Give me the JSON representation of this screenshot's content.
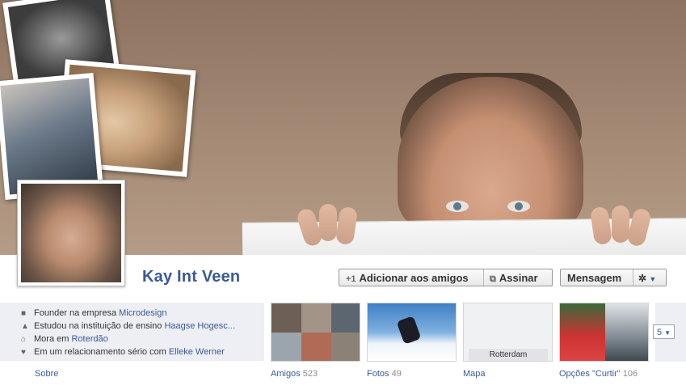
{
  "profile": {
    "name": "Kay Int Veen"
  },
  "actions": {
    "add_friend_label": "Adicionar aos amigos",
    "subscribe_label": "Assinar",
    "message_label": "Mensagem"
  },
  "about": {
    "items": [
      {
        "prefix": "Founder na empresa ",
        "link": "Microdesign",
        "icon": "briefcase-icon"
      },
      {
        "prefix": "Estudou na instituição de ensino ",
        "link": "Haagse Hogesc...",
        "icon": "graduation-cap-icon"
      },
      {
        "prefix": "Mora em ",
        "link": "Roterdão",
        "icon": "house-icon"
      },
      {
        "prefix": "Em um relacionamento sério com ",
        "link": "Elleke Werner",
        "icon": "heart-icon"
      }
    ],
    "section_label": "Sobre"
  },
  "tiles": {
    "friends": {
      "label": "Amigos",
      "count": "523"
    },
    "photos": {
      "label": "Fotos",
      "count": "49"
    },
    "map": {
      "label": "Mapa",
      "city": "Rotterdam"
    },
    "likes": {
      "label": "Opções \"Curtir\"",
      "count": "106"
    },
    "more_count": "5"
  },
  "colors": {
    "link": "#3b5998",
    "info_bg": "#edeff4",
    "cover_brown": "#a58b76"
  }
}
